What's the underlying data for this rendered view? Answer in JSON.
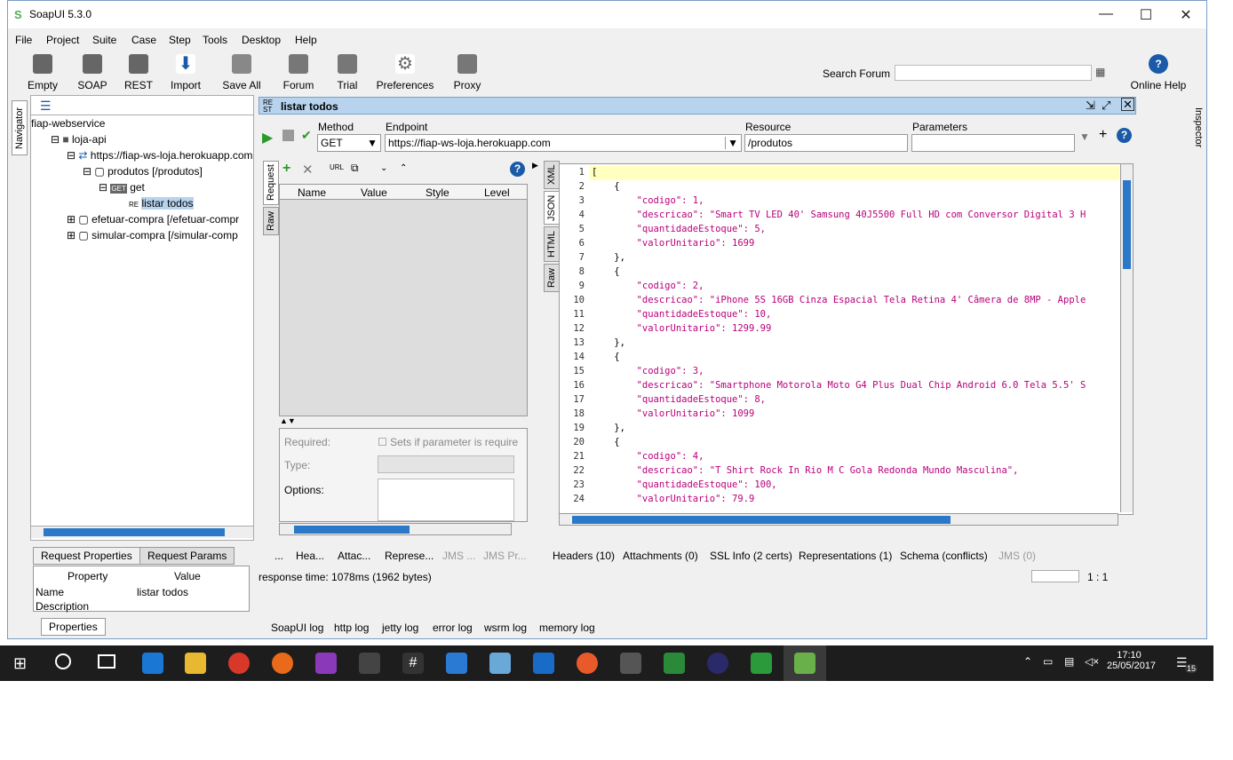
{
  "window": {
    "title": "SoapUI 5.3.0",
    "min": "—",
    "max": "☐",
    "close": "✕"
  },
  "menu": [
    "File",
    "Project",
    "Suite",
    "Case",
    "Step",
    "Tools",
    "Desktop",
    "Help"
  ],
  "toolbar": [
    {
      "label": "Empty",
      "icon": "empty-project-icon"
    },
    {
      "label": "SOAP",
      "icon": "soap-icon"
    },
    {
      "label": "REST",
      "icon": "rest-icon"
    },
    {
      "label": "Import",
      "icon": "import-icon"
    },
    {
      "label": "Save All",
      "icon": "save-all-icon"
    },
    {
      "label": "Forum",
      "icon": "forum-icon"
    },
    {
      "label": "Trial",
      "icon": "trial-icon"
    },
    {
      "label": "Preferences",
      "icon": "gear-icon"
    },
    {
      "label": "Proxy",
      "icon": "proxy-icon"
    },
    {
      "label": "Online Help",
      "icon": "help-icon"
    }
  ],
  "search": {
    "label": "Search Forum",
    "value": ""
  },
  "navigator": {
    "tab": "Navigator",
    "inspector": "Inspector",
    "tree": [
      "fiap-webservice",
      "loja-api",
      "https://fiap-ws-loja.herokuapp.com",
      "produtos [/produtos]",
      "get",
      "listar todos",
      "efetuar-compra [/efetuar-compr",
      "simular-compra [/simular-comp"
    ]
  },
  "props": {
    "tabs": [
      "Request Properties",
      "Request Params"
    ],
    "headers": [
      "Property",
      "Value"
    ],
    "rows": [
      [
        "Name",
        "listar todos"
      ],
      [
        "Description",
        ""
      ]
    ],
    "button": "Properties"
  },
  "request": {
    "title": "listar todos",
    "method_label": "Method",
    "method": "GET",
    "endpoint_label": "Endpoint",
    "endpoint": "https://fiap-ws-loja.herokuapp.com",
    "resource_label": "Resource",
    "resource": "/produtos",
    "params_label": "Parameters",
    "params": ""
  },
  "reqtabs": [
    "Request",
    "Raw"
  ],
  "grid": {
    "headers": [
      "Name",
      "Value",
      "Style",
      "Level"
    ]
  },
  "detail": {
    "required": "Required:",
    "required_hint": "Sets if parameter is require",
    "type": "Type:",
    "options": "Options:"
  },
  "resptabs": [
    "XML",
    "JSON",
    "HTML",
    "Raw"
  ],
  "response": {
    "lines": [
      "[",
      "    {",
      "        \"codigo\": 1,",
      "        \"descricao\": \"Smart TV LED 40' Samsung 40J5500 Full HD com Conversor Digital 3 H",
      "        \"quantidadeEstoque\": 5,",
      "        \"valorUnitario\": 1699",
      "    },",
      "    {",
      "        \"codigo\": 2,",
      "        \"descricao\": \"iPhone 5S 16GB Cinza Espacial Tela Retina 4' Câmera de 8MP - Apple",
      "        \"quantidadeEstoque\": 10,",
      "        \"valorUnitario\": 1299.99",
      "    },",
      "    {",
      "        \"codigo\": 3,",
      "        \"descricao\": \"Smartphone Motorola Moto G4 Plus Dual Chip Android 6.0 Tela 5.5' S",
      "        \"quantidadeEstoque\": 8,",
      "        \"valorUnitario\": 1099",
      "    },",
      "    {",
      "        \"codigo\": 4,",
      "        \"descricao\": \"T Shirt Rock In Rio M C Gola Redonda Mundo Masculina\",",
      "        \"quantidadeEstoque\": 100,",
      "        \"valorUnitario\": 79.9"
    ]
  },
  "reqbottom": [
    "...",
    "Hea...",
    "Attac...",
    "Represe...",
    "JMS ...",
    "JMS Pr..."
  ],
  "respbottom": [
    "Headers (10)",
    "Attachments (0)",
    "SSL Info (2 certs)",
    "Representations (1)",
    "Schema (conflicts)",
    "JMS (0)"
  ],
  "status": {
    "time": "response time: 1078ms (1962 bytes)",
    "pos": "1 : 1"
  },
  "logs": [
    "SoapUI log",
    "http log",
    "jetty log",
    "error log",
    "wsrm log",
    "memory log"
  ],
  "clock": {
    "time": "17:10",
    "date": "25/05/2017",
    "notif": "15"
  }
}
